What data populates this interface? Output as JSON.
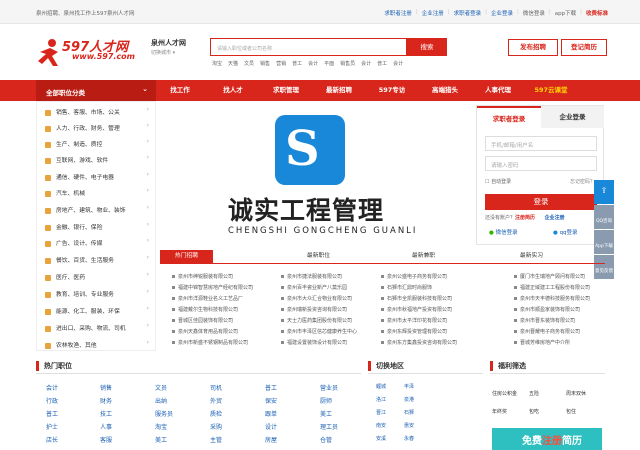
{
  "topbar": {
    "left_text": "泉州招聘、泉州找工作上597泉州人才网",
    "links": [
      "求职者注册",
      "企业注册",
      "求职者登录",
      "企业登录",
      "微信登录",
      "app下载",
      "收费标准"
    ]
  },
  "header": {
    "logo_text": "597人才网",
    "logo_url": "www.597.com",
    "city": "泉州人才网",
    "city_switch": "切换城市",
    "search_placeholder": "请输入职位或者公司名称",
    "search_button": "搜索",
    "hot_words": [
      "淘宝",
      "天猫",
      "文员",
      "销售",
      "营销",
      "普工",
      "会计",
      "平面",
      "销售员",
      "会计",
      "普工",
      "会计"
    ],
    "post_job": "发布招聘",
    "register_resume": "登记简历"
  },
  "nav": {
    "category_label": "全部职位分类",
    "items": [
      "找工作",
      "找人才",
      "求职管理",
      "最新招聘",
      "597专访",
      "高端猎头",
      "人事代理",
      "597云课堂"
    ]
  },
  "categories": [
    "销售、客服、市场、公关",
    "人力、行政、财务、管理",
    "生产、制造、质控",
    "互联网、游戏、软件",
    "通信、硬件、电子电器",
    "汽车、机械",
    "房地产、建筑、物业、装饰",
    "金融、银行、保险",
    "广告、设计、传媒",
    "餐饮、百货、生活服务",
    "医疗、医药",
    "教育、培训、专业服务",
    "能源、化工、服装、环保",
    "进出口、采购、物流、司机",
    "农林牧渔、其他"
  ],
  "banner": {
    "logo_letter": "S",
    "title": "诚实工程管理",
    "subtitle": "CHENGSHI GONGCHENG GUANLI"
  },
  "login": {
    "tab_jobseeker": "求职者登录",
    "tab_company": "企业登录",
    "username_placeholder": "手机/邮箱/用户名",
    "password_placeholder": "请输入密码",
    "auto_login": "自动登录",
    "forgot": "忘记密码？",
    "login_button": "登录",
    "no_account": "还没有账户？",
    "register_resume": "注册简历",
    "company_register": "企业注册",
    "wechat_login": "微信登录",
    "qq_login": "qq登录"
  },
  "sidebar": [
    "快速",
    "QQ咨询",
    "App下载",
    "意见反馈"
  ],
  "tabs": [
    "热门招聘",
    "最新职位",
    "最新兼职",
    "最新实习"
  ],
  "companies": [
    [
      "泉州市绅锐服装有限公司",
      "泉州市捷法服装有限公司",
      "泉州公盛电子商务有限公司",
      "厦门市生瑞地产顾问有限公司"
    ],
    [
      "福建中锦智慧房地产经纪有限公司",
      "泉州百丰瓷业新产八莫乐园",
      "石狮市汇鼎时尚服饰",
      "福建正域建工工程股份有限公司"
    ],
    [
      "泉州市洋源鞋业名义工艺品厂",
      "泉州市大众汇合物业有限公司",
      "石狮市全凯服装科技有限公司",
      "泉州市天丰德科技服务有限公司"
    ],
    [
      "福建戴尔生物科技有限公司",
      "泉州瑞新投资咨询有限公司",
      "泉州市秋福地产投资有限公司",
      "泉州市顺盈家装饰有限公司"
    ],
    [
      "晋城区佳园装饰有限公司",
      "天士力医药集团股份有限公司",
      "泉州市太平洋印花有限公司",
      "泉州市晋东装饰有限公司"
    ],
    [
      "泉州天鑫体育用品有限公司",
      "泉州市丰泽区信芯健康养生中心",
      "泉州东辉投资管理有限公司",
      "泉州晋耀电子商务有限公司"
    ],
    [
      "泉州市新盛不锈钢制品有限公司",
      "福建设置装饰设计有限公司",
      "泉州东方集鑫投资咨询有限公司",
      "晋城芳维房地产中介所"
    ]
  ],
  "hot_jobs": {
    "title": "热门职位",
    "rows": [
      [
        "会计",
        "销售",
        "文员",
        "司机",
        "普工",
        "营业员"
      ],
      [
        "行政",
        "财务",
        "出纳",
        "外贸",
        "保安",
        "厨师"
      ],
      [
        "普工",
        "技工",
        "服务员",
        "质检",
        "跟单",
        "美工"
      ],
      [
        "护士",
        "人事",
        "淘宝",
        "采购",
        "设计",
        "理工员"
      ],
      [
        "店长",
        "客服",
        "美工",
        "主管",
        "房屋",
        "仓管"
      ]
    ]
  },
  "areas": {
    "title": "切换地区",
    "rows": [
      [
        "鲤城",
        "丰泽"
      ],
      [
        "洛江",
        "泉港"
      ],
      [
        "晋江",
        "石狮"
      ],
      [
        "南安",
        "惠安"
      ],
      [
        "安溪",
        "永春"
      ]
    ]
  },
  "welfare": {
    "title": "福利筛选",
    "items": [
      "住房公积金",
      "五险",
      "周末双休",
      "年终奖",
      "包吃",
      "包住"
    ]
  },
  "promo": {
    "free": "免费",
    "register": "注册",
    "resume": "简历"
  },
  "colors": {
    "brand_red": "#d9261c",
    "link_blue": "#1a5fb4",
    "logo_blue": "#1a88d8"
  }
}
